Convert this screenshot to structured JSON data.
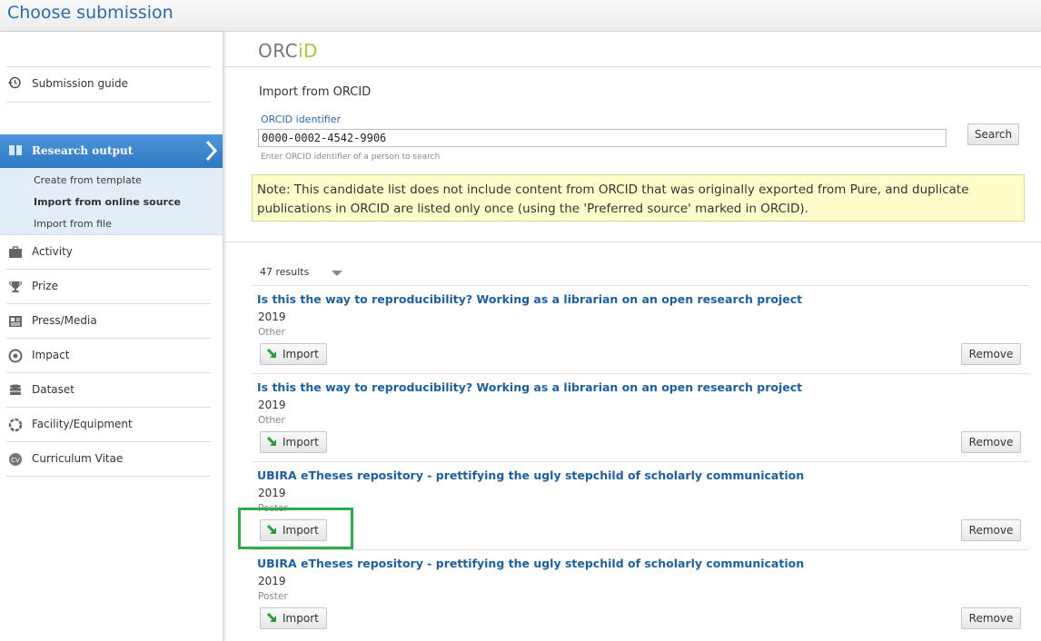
{
  "window": {
    "title": "Choose submission"
  },
  "sidebar": {
    "guide": {
      "label": "Submission guide",
      "icon": "history-icon"
    },
    "research_output": {
      "label": "Research output",
      "subitems": [
        "Create from template",
        "Import from online source",
        "Import from file"
      ],
      "active_subitem": "Import from online source"
    },
    "nav": [
      {
        "label": "Activity",
        "icon": "briefcase-icon"
      },
      {
        "label": "Prize",
        "icon": "trophy-icon"
      },
      {
        "label": "Press/Media",
        "icon": "newspaper-icon"
      },
      {
        "label": "Impact",
        "icon": "target-icon"
      },
      {
        "label": "Dataset",
        "icon": "database-icon"
      },
      {
        "label": "Facility/Equipment",
        "icon": "gear-ring-icon"
      },
      {
        "label": "Curriculum Vitae",
        "icon": "cv-icon"
      }
    ]
  },
  "main": {
    "logo": {
      "text": "ORC",
      "accent": "iD"
    },
    "heading": "Import from ORCID",
    "orcid_field": {
      "label": "ORCID identifier",
      "value": "0000-0002-4542-9906",
      "hint": "Enter ORCID identifier of a person to search"
    },
    "search_label": "Search",
    "note": "Note: This candidate list does not include content from ORCID that was originally exported from Pure, and duplicate publications in ORCID are listed only once (using the 'Preferred source' marked in ORCID).",
    "results_count": "47 results",
    "import_label": "Import",
    "remove_label": "Remove",
    "items": [
      {
        "title": "Is this the way to reproducibility? Working as a librarian on an open research project",
        "year": "2019",
        "type": "Other"
      },
      {
        "title": "Is this the way to reproducibility? Working as a librarian on an open research project",
        "year": "2019",
        "type": "Other"
      },
      {
        "title": "UBIRA eTheses repository - prettifying the ugly stepchild of scholarly communication",
        "year": "2019",
        "type": "Poster"
      },
      {
        "title": "UBIRA eTheses repository - prettifying the ugly stepchild of scholarly communication",
        "year": "2019",
        "type": "Poster"
      }
    ]
  },
  "colors": {
    "accent": "#2f78c3",
    "highlight": "#2faa4a",
    "orcid_green": "#a6ce39",
    "note_bg": "#ffffcc"
  }
}
